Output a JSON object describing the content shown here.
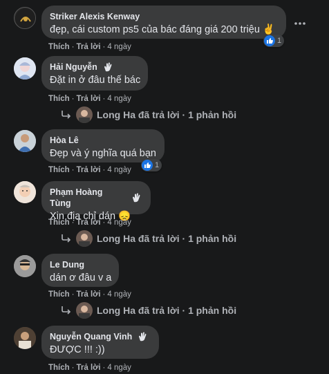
{
  "colors": {
    "background": "#18191a",
    "bubble": "#3a3b3c",
    "meta": "#b0b3b8",
    "like": "#1b74e4"
  },
  "comments": [
    {
      "author": "Striker Alexis Kenway",
      "text": "đẹp, cái custom ps5 của bác đáng giá 200 triệu ✌",
      "like": "Thích",
      "reply": "Trả lời",
      "time": "4 ngày",
      "reactions": "1"
    },
    {
      "author": "Hải Nguyễn",
      "text": "Đặt in ở đâu thế bác",
      "like": "Thích",
      "reply": "Trả lời",
      "time": "4 ngày",
      "reply_summary": {
        "name": "Long Ha",
        "suffix": "đã trả lời · 1 phản hồi"
      }
    },
    {
      "author": "Hòa Lê",
      "text": "Đẹp và ý nghĩa quá bạn",
      "like": "Thích",
      "reply": "Trả lời",
      "time": "4 ngày",
      "reactions": "1"
    },
    {
      "author": "Phạm Hoàng Tùng",
      "text": "Xin địa chỉ dán 😞",
      "like": "Thích",
      "reply": "Trả lời",
      "time": "4 ngày",
      "reply_summary": {
        "name": "Long Ha",
        "suffix": "đã trả lời · 1 phản hồi"
      }
    },
    {
      "author": "Le Dung",
      "text": "dán ơ đâu v a",
      "like": "Thích",
      "reply": "Trả lời",
      "time": "4 ngày",
      "reply_summary": {
        "name": "Long Ha",
        "suffix": "đã trả lời · 1 phản hồi"
      }
    },
    {
      "author": "Nguyễn Quang Vinh",
      "text": "ĐƯỢC !!! :))",
      "like": "Thích",
      "reply": "Trả lời",
      "time": "4 ngày"
    }
  ]
}
